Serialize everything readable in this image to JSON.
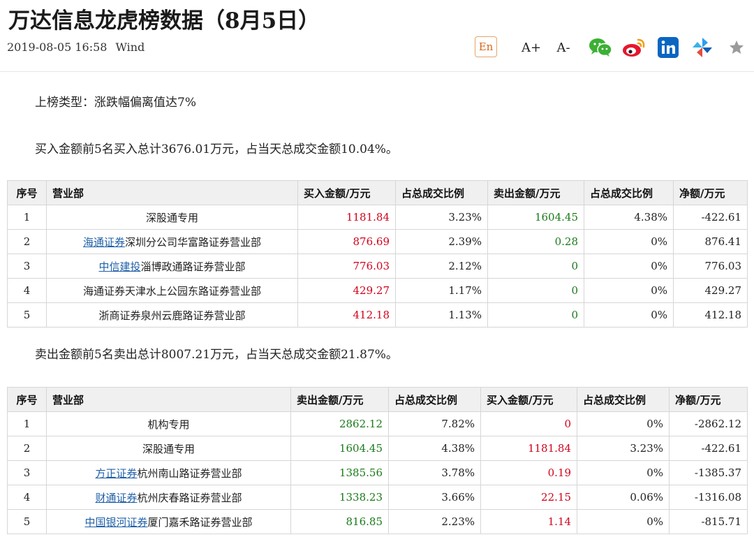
{
  "article": {
    "title": "万达信息龙虎榜数据（8月5日）",
    "date": "2019-08-05 16:58",
    "source": "Wind"
  },
  "toolbar": {
    "en_label": "En",
    "font_increase": "A+",
    "font_decrease": "A-",
    "icons": [
      "wechat-icon",
      "weibo-icon",
      "linkedin-icon",
      "pinwheel-icon",
      "star-icon"
    ],
    "colors": {
      "wechat": "#3cb034",
      "weibo": "#e6162d",
      "linkedin": "#0a66c2",
      "en_border": "#e4a56a"
    }
  },
  "content": {
    "list_type": "上榜类型：涨跌幅偏离值达7%",
    "buy_summary": "买入金额前5名买入总计3676.01万元，占当天总成交金额10.04%。",
    "sell_summary": "卖出金额前5名卖出总计8007.21万元，占当天总成交金额21.87%。"
  },
  "buy_table": {
    "headers": [
      "序号",
      "营业部",
      "买入金额/万元",
      "占总成交比例",
      "卖出金额/万元",
      "占总成交比例",
      "净额/万元"
    ],
    "rows": [
      {
        "idx": "1",
        "link": "",
        "dept": "深股通专用",
        "buy": "1181.84",
        "buy_pct": "3.23%",
        "sell": "1604.45",
        "sell_pct": "4.38%",
        "net": "-422.61"
      },
      {
        "idx": "2",
        "link": "海通证券",
        "dept": "深圳分公司华富路证券营业部",
        "buy": "876.69",
        "buy_pct": "2.39%",
        "sell": "0.28",
        "sell_pct": "0%",
        "net": "876.41"
      },
      {
        "idx": "3",
        "link": "中信建投",
        "dept": "淄博政通路证券营业部",
        "buy": "776.03",
        "buy_pct": "2.12%",
        "sell": "0",
        "sell_pct": "0%",
        "net": "776.03"
      },
      {
        "idx": "4",
        "link": "",
        "dept": "海通证券天津水上公园东路证券营业部",
        "buy": "429.27",
        "buy_pct": "1.17%",
        "sell": "0",
        "sell_pct": "0%",
        "net": "429.27"
      },
      {
        "idx": "5",
        "link": "",
        "dept": "浙商证券泉州云鹿路证券营业部",
        "buy": "412.18",
        "buy_pct": "1.13%",
        "sell": "0",
        "sell_pct": "0%",
        "net": "412.18"
      }
    ]
  },
  "sell_table": {
    "headers": [
      "序号",
      "营业部",
      "卖出金额/万元",
      "占总成交比例",
      "买入金额/万元",
      "占总成交比例",
      "净额/万元"
    ],
    "rows": [
      {
        "idx": "1",
        "link": "",
        "dept": "机构专用",
        "sell": "2862.12",
        "sell_pct": "7.82%",
        "buy": "0",
        "buy_pct": "0%",
        "net": "-2862.12"
      },
      {
        "idx": "2",
        "link": "",
        "dept": "深股通专用",
        "sell": "1604.45",
        "sell_pct": "4.38%",
        "buy": "1181.84",
        "buy_pct": "3.23%",
        "net": "-422.61"
      },
      {
        "idx": "3",
        "link": "方正证券",
        "dept": "杭州南山路证券营业部",
        "sell": "1385.56",
        "sell_pct": "3.78%",
        "buy": "0.19",
        "buy_pct": "0%",
        "net": "-1385.37"
      },
      {
        "idx": "4",
        "link": "财通证券",
        "dept": "杭州庆春路证券营业部",
        "sell": "1338.23",
        "sell_pct": "3.66%",
        "buy": "22.15",
        "buy_pct": "0.06%",
        "net": "-1316.08"
      },
      {
        "idx": "5",
        "link": "中国银河证券",
        "dept": "厦门嘉禾路证券营业部",
        "sell": "816.85",
        "sell_pct": "2.23%",
        "buy": "1.14",
        "buy_pct": "0%",
        "net": "-815.71"
      }
    ]
  }
}
